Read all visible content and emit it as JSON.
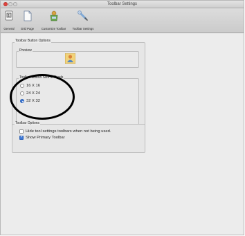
{
  "window": {
    "title": "Toolbar Settings"
  },
  "toolbar": {
    "items": [
      {
        "label": "General",
        "icon": "general-icon"
      },
      {
        "label": "Grid Page",
        "icon": "grid-page-icon"
      },
      {
        "label": "Customize Toolbar",
        "icon": "customize-toolbar-icon"
      },
      {
        "label": "Toolbar Settings",
        "icon": "toolbar-settings-icon"
      }
    ]
  },
  "toolbar_button_options": {
    "label": "Toolbar Button Options",
    "preview_label": "Preview",
    "size_group_label": "Toolbar Button Size in Pixels",
    "sizes": [
      {
        "label": "16 X 16",
        "selected": false
      },
      {
        "label": "24 X 24",
        "selected": false
      },
      {
        "label": "32 X 32",
        "selected": true
      }
    ]
  },
  "toolbar_options": {
    "label": "Toolbar Options",
    "checkboxes": [
      {
        "label": "Hide tool settings toolbars when not being used.",
        "checked": false
      },
      {
        "label": "Show Primary Toolbar",
        "checked": true
      }
    ]
  },
  "colors": {
    "accent": "#3d78d6",
    "close": "#e2433e"
  }
}
